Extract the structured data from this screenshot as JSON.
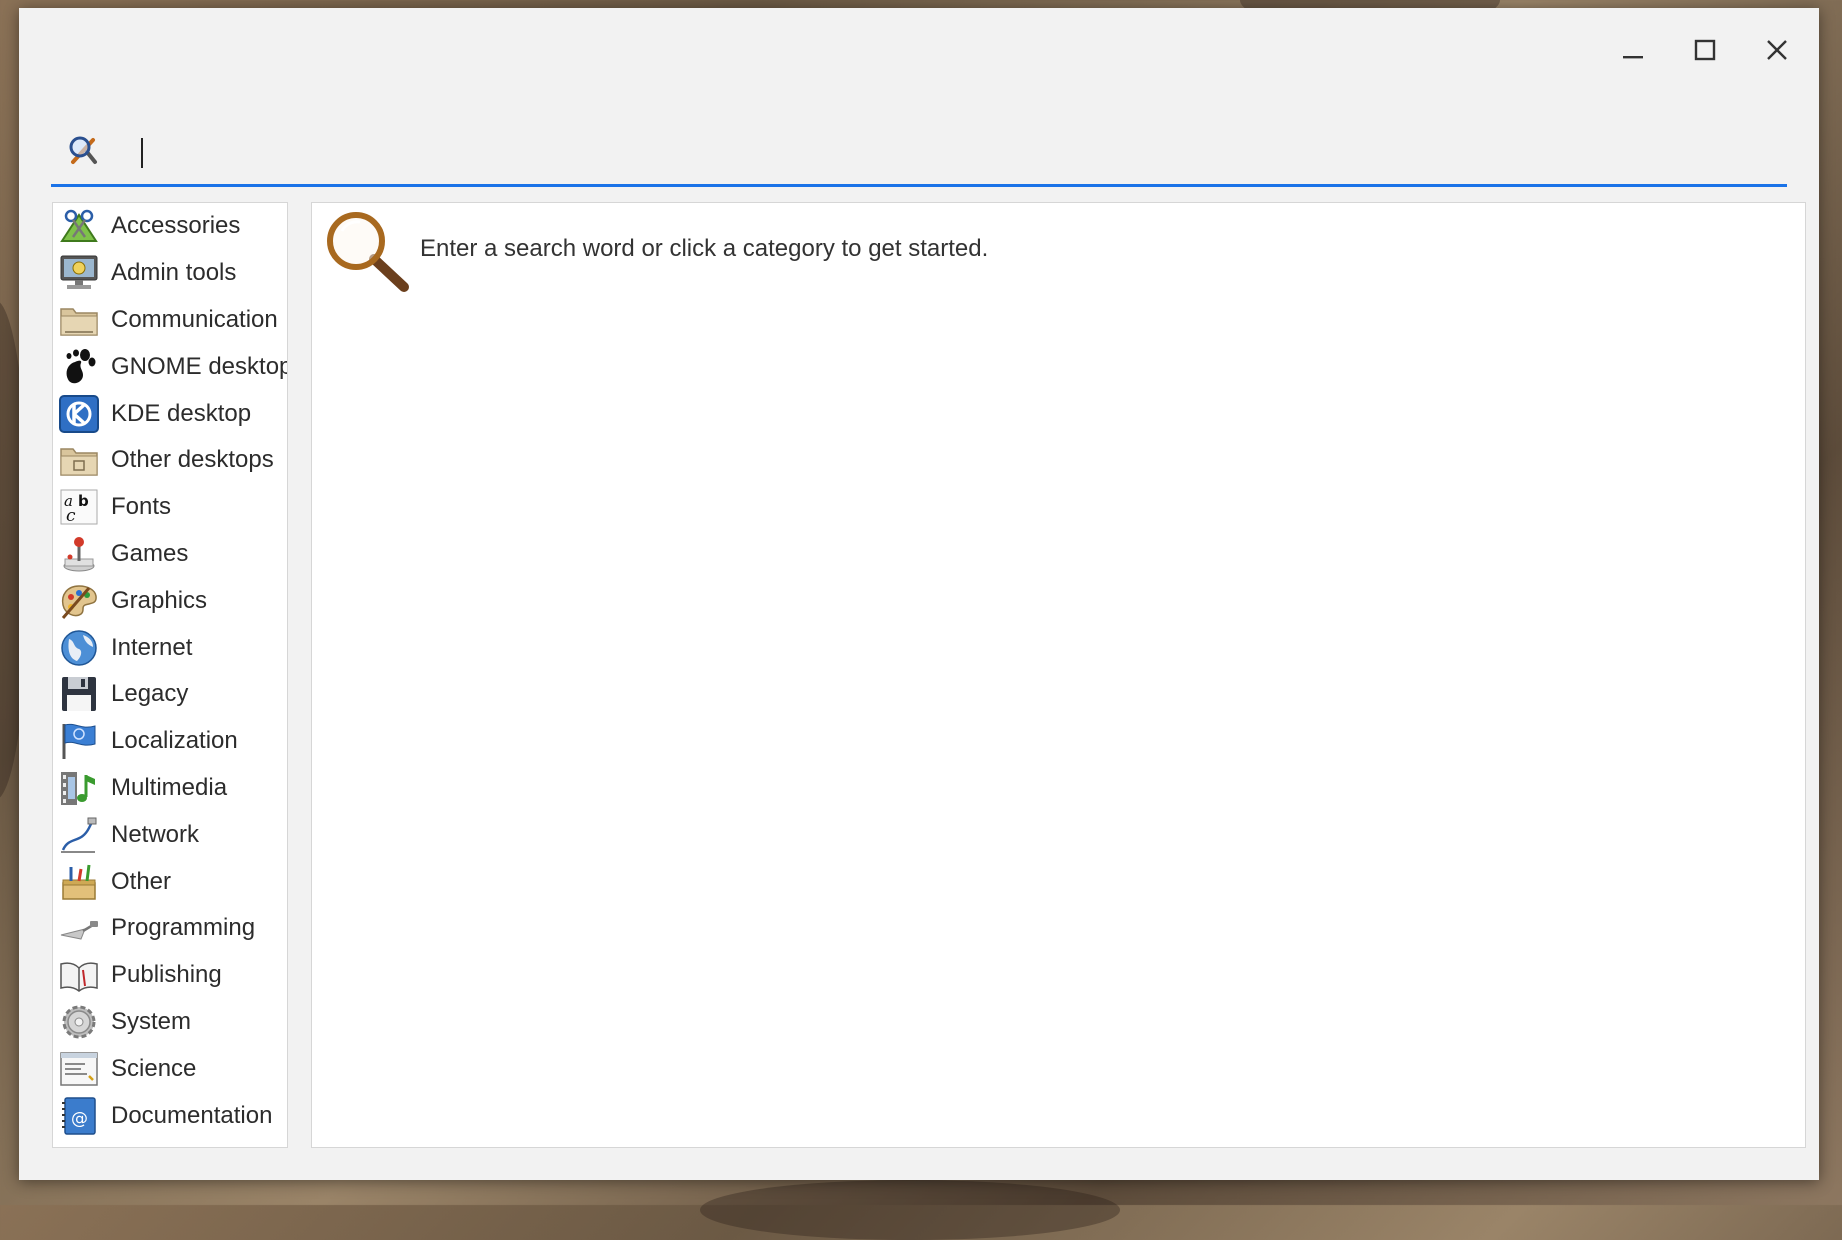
{
  "window": {
    "controls": [
      {
        "icon": "minimize-icon"
      },
      {
        "icon": "maximize-icon"
      },
      {
        "icon": "close-icon"
      }
    ]
  },
  "search": {
    "icon": "search-tools-icon",
    "value": "",
    "placeholder": ""
  },
  "categories": [
    {
      "label": "Accessories",
      "icon": "accessories-icon"
    },
    {
      "label": "Admin tools",
      "icon": "admin-tools-icon"
    },
    {
      "label": "Communication",
      "icon": "communication-icon"
    },
    {
      "label": "GNOME desktop",
      "icon": "gnome-foot-icon"
    },
    {
      "label": "KDE desktop",
      "icon": "kde-icon"
    },
    {
      "label": "Other desktops",
      "icon": "other-desktops-icon"
    },
    {
      "label": "Fonts",
      "icon": "fonts-icon"
    },
    {
      "label": "Games",
      "icon": "joystick-icon"
    },
    {
      "label": "Graphics",
      "icon": "palette-icon"
    },
    {
      "label": "Internet",
      "icon": "globe-icon"
    },
    {
      "label": "Legacy",
      "icon": "floppy-disk-icon"
    },
    {
      "label": "Localization",
      "icon": "flag-icon"
    },
    {
      "label": "Multimedia",
      "icon": "multimedia-icon"
    },
    {
      "label": "Network",
      "icon": "network-icon"
    },
    {
      "label": "Other",
      "icon": "toolbox-icon"
    },
    {
      "label": "Programming",
      "icon": "trowel-icon"
    },
    {
      "label": "Publishing",
      "icon": "book-icon"
    },
    {
      "label": "System",
      "icon": "gear-icon"
    },
    {
      "label": "Science",
      "icon": "science-icon"
    },
    {
      "label": "Documentation",
      "icon": "documentation-icon"
    }
  ],
  "main": {
    "hint_icon": "magnifier-icon",
    "hint": "Enter a search word or click a category to get started."
  },
  "colors": {
    "accent": "#1a73e8",
    "window_bg": "#f2f2f2",
    "panel_bg": "#ffffff"
  }
}
